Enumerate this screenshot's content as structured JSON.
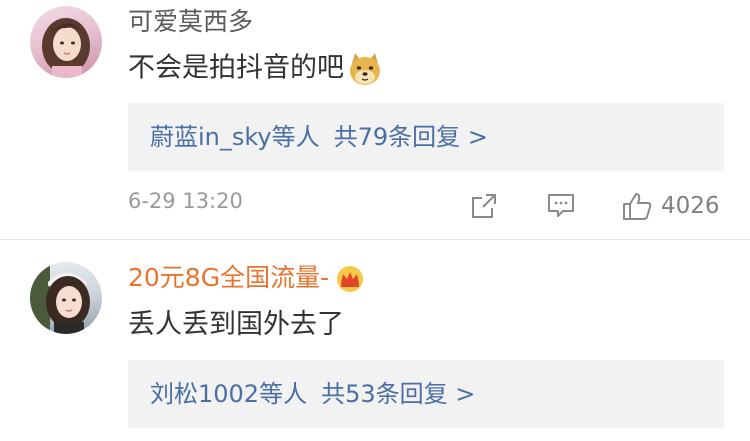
{
  "comments": [
    {
      "username": "可爱莫西多",
      "text": "不会是拍抖音的吧",
      "emoji": "doge-emoji",
      "replies": {
        "users": "蔚蓝in_sky等人",
        "count_label": "共79条回复",
        "arrow": ">"
      },
      "time": "6-29 13:20",
      "likes": "4026"
    },
    {
      "username": "20元8G全国流量-",
      "badge": "crown-icon",
      "text": "丢人丢到国外去了",
      "replies": {
        "users": "刘松1002等人",
        "count_label": "共53条回复",
        "arrow": ">"
      }
    }
  ],
  "colors": {
    "link": "#4a6fa5",
    "vip_name": "#e8742d",
    "normal_name": "#5b5b5b",
    "meta": "#9a9a9a",
    "reply_bg": "#f2f2f2"
  }
}
